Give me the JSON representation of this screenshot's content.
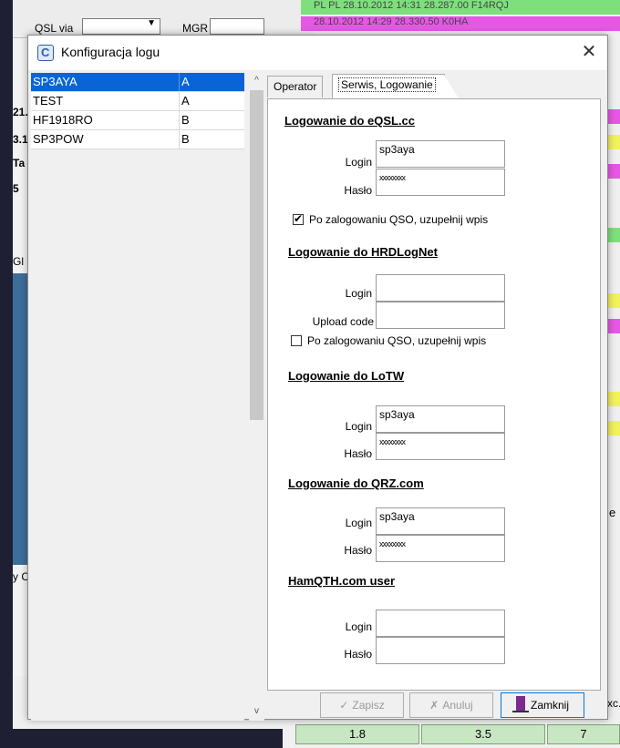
{
  "background": {
    "qsl_via_label": "QSL via",
    "mgr_label": "MGR",
    "log_rows": [
      {
        "text": "PL    PL    28.10.2012  14:31    28.287.00  F14RQJ",
        "color": "#7de07d"
      },
      {
        "text": "          28.10.2012  14:29    28.330.50  K0HA",
        "color": "#e657e6"
      }
    ],
    "left_labels": [
      "21.",
      "3.1",
      "Ta",
      "5",
      "Gl",
      "y C"
    ],
    "bottom_cells": [
      "1.8",
      "3.5",
      "7"
    ],
    "right_labels": [
      "e",
      "xc."
    ]
  },
  "dialog": {
    "title": "Konfiguracja logu",
    "close_label": "✕",
    "logs": [
      {
        "name": "SP3AYA",
        "type": "A",
        "selected": true
      },
      {
        "name": "TEST",
        "type": "A",
        "selected": false
      },
      {
        "name": "HF1918RO",
        "type": "B",
        "selected": false
      },
      {
        "name": "SP3POW",
        "type": "B",
        "selected": false
      }
    ],
    "scroll_up": "^",
    "scroll_down": "v",
    "tabs": [
      {
        "label": "Operator",
        "active": false
      },
      {
        "label": "Serwis, Logowanie",
        "active": true
      }
    ],
    "eqsl": {
      "title": "Logowanie do eQSL.cc",
      "login_label": "Login",
      "login_value": "sp3aya",
      "password_label": "Hasło",
      "password_value": "xxxxxxxx",
      "auto_label": "Po zalogowaniu QSO, uzupełnij wpis",
      "auto_checked": true
    },
    "hrdlog": {
      "title": "Logowanie do HRDLogNet",
      "login_label": "Login",
      "login_value": "",
      "upload_label": "Upload code",
      "upload_value": "",
      "auto_label": "Po zalogowaniu QSO, uzupełnij wpis",
      "auto_checked": false
    },
    "lotw": {
      "title": "Logowanie do LoTW",
      "login_label": "Login",
      "login_value": "sp3aya",
      "password_label": "Hasło",
      "password_value": "xxxxxxxx"
    },
    "qrz": {
      "title": "Logowanie do QRZ.com",
      "login_label": "Login",
      "login_value": "sp3aya",
      "password_label": "Hasło",
      "password_value": "xxxxxxxx"
    },
    "hamqth": {
      "title": "HamQTH.com user",
      "login_label": "Login",
      "login_value": "",
      "password_label": "Hasło",
      "password_value": ""
    },
    "buttons": {
      "save": "Zapisz",
      "cancel": "Anuluj",
      "close": "Zamknij"
    }
  },
  "colors": {
    "selection": "#0a64d6",
    "row_green": "#7de07d",
    "row_magenta": "#e657e6",
    "row_yellow": "#f2f25a",
    "focus_border": "#0078d7"
  }
}
